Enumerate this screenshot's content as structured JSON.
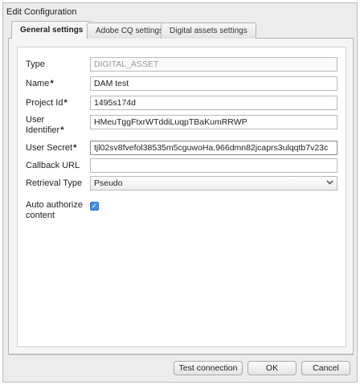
{
  "dialog": {
    "title": "Edit Configuration"
  },
  "tabs": [
    {
      "label": "General settings",
      "active": true
    },
    {
      "label": "Adobe CQ settings",
      "active": false
    },
    {
      "label": "Digital assets settings",
      "active": false
    }
  ],
  "form": {
    "type": {
      "label": "Type",
      "value": "DIGITAL_ASSET"
    },
    "name": {
      "label": "Name",
      "required": "*",
      "value": "DAM test"
    },
    "project_id": {
      "label": "Project Id",
      "required": "*",
      "value": "1495s174d"
    },
    "user_identifier": {
      "label_line1": "User",
      "label_line2": "Identifier",
      "required": "*",
      "value": "HMeuTggFtxrWTddiLuqpTBaKumRRWP"
    },
    "user_secret": {
      "label": "User Secret",
      "required": "*",
      "value": "tjl02sv8fvefol38535m5cguwoHa.966dmn82jcaprs3ulqqtb7v23c"
    },
    "callback_url": {
      "label": "Callback URL",
      "value": ""
    },
    "retrieval_type": {
      "label": "Retrieval Type",
      "value": "Pseudo",
      "icon": "chevron-down-icon"
    },
    "auto_authorize": {
      "label_line1": "Auto authorize",
      "label_line2": "content",
      "checked": true,
      "check_glyph": "✓"
    }
  },
  "footer": {
    "test_connection": "Test connection",
    "ok": "OK",
    "cancel": "Cancel"
  },
  "colors": {
    "checkbox": "#3f8fe6",
    "background": "#ececec"
  }
}
